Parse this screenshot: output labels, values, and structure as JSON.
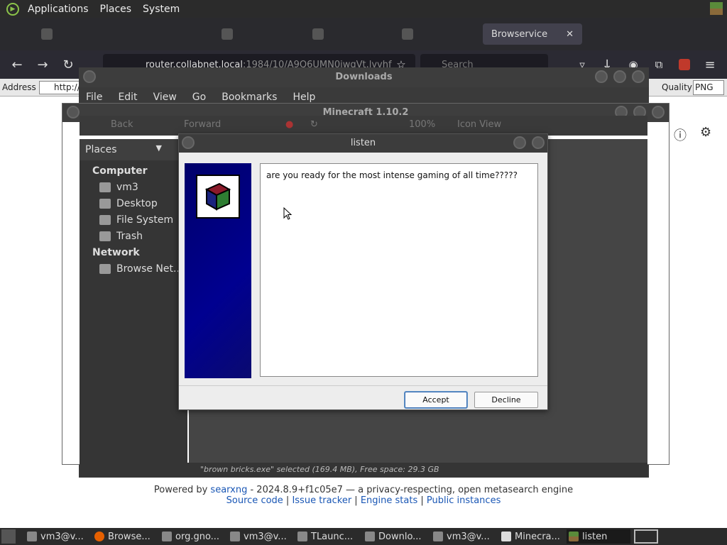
{
  "top_panel": {
    "menus": [
      "Applications",
      "Places",
      "System"
    ]
  },
  "browser": {
    "tabs": [
      {
        "label": "Browservice",
        "close": "✕"
      }
    ],
    "url": {
      "host": "router.collabnet.local",
      "rest": ":1984/10/A9Q6UMN0iwqVt.lyvhf"
    },
    "search_placeholder": "Search"
  },
  "address_row": {
    "label": "Address",
    "value": "http://",
    "quality_label": "Quality",
    "quality_value": "PNG"
  },
  "downloads_window": {
    "title": "Downloads",
    "menus": [
      "File",
      "Edit",
      "View",
      "Go",
      "Bookmarks",
      "Help"
    ]
  },
  "minecraft_window": {
    "title": "Minecraft 1.10.2",
    "toolbar": {
      "back": "Back",
      "forward": "Forward",
      "zoom": "100%",
      "view": "Icon View"
    }
  },
  "places": {
    "header": "Places",
    "sections": [
      {
        "title": "Computer",
        "items": [
          "vm3",
          "Desktop",
          "File System",
          "Trash"
        ]
      },
      {
        "title": "Network",
        "items": [
          "Browse Net..."
        ]
      }
    ]
  },
  "status_bar": "\"brown bricks.exe\" selected (169.4 MB), Free space: 29.3 GB",
  "listen_dialog": {
    "title": "listen",
    "message": "are you ready for the most intense gaming of all time?????",
    "accept": "Accept",
    "decline": "Decline"
  },
  "footer": {
    "powered_by": "Powered by",
    "engine_link": "searxng",
    "version_text": " - 2024.8.9+f1c05e7 — a privacy-respecting, open metasearch engine",
    "links": [
      "Source code",
      "Issue tracker",
      "Engine stats",
      "Public instances"
    ],
    "separator": " | "
  },
  "taskbar": {
    "tasks": [
      "vm3@v...",
      "Browse...",
      "org.gno...",
      "vm3@v...",
      "TLaunc...",
      "Downlo...",
      "vm3@v...",
      "Minecra...",
      "listen"
    ]
  },
  "colors": {
    "panel": "#2b2b2b",
    "link": "#1a57b5",
    "dialog_side": "#000090"
  }
}
